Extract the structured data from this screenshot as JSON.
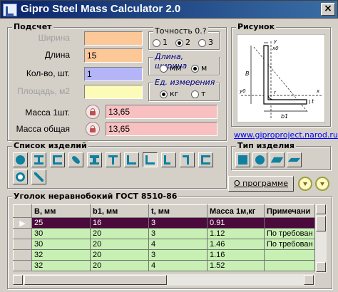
{
  "window": {
    "title": "Gipro Steel Mass Calculator 2.0",
    "close_glyph": "×"
  },
  "calc": {
    "legend": "Подсчет",
    "width_label": "Ширина",
    "length_label": "Длина",
    "length_value": "15",
    "count_label": "Кол-во, шт.",
    "count_value": "1",
    "area_label": "Площадь, м2",
    "mass_one_label": "Масса 1шт.",
    "mass_one_value": "13,65",
    "mass_total_label": "Масса общая",
    "mass_total_value": "13,65",
    "precision": {
      "legend": "Точность 0.?",
      "options": [
        "1",
        "2",
        "3"
      ],
      "selected": "2"
    },
    "length_units": {
      "legend": "Длина, ширина",
      "options": [
        "мм",
        "м"
      ],
      "selected": "м"
    },
    "mass_units": {
      "legend": "Ед. измерения",
      "options": [
        "кг",
        "т"
      ],
      "selected": "кг"
    }
  },
  "figure": {
    "legend": "Рисунок",
    "labels": {
      "width": "b1",
      "height": "B",
      "thickness": "t",
      "r": "r",
      "x0": "x0",
      "y0": "y0",
      "x": "x",
      "y": "y"
    }
  },
  "website_link": "www.giproproject.narod.ru",
  "products": {
    "legend": "Список изделий",
    "icons": [
      "circle-bar-icon",
      "i-beam-icon",
      "channel-icon",
      "rod-icon",
      "rail-icon",
      "t-beam-icon",
      "square-bar-icon",
      "equal-angle-icon",
      "unequal-angle-icon",
      "zee-icon",
      "hex-bar-icon",
      "pipe-icon",
      "diagonal-rod-icon"
    ]
  },
  "product_type": {
    "legend": "Тип изделия",
    "icons": [
      "square-type-icon",
      "round-type-icon",
      "flat-type-icon",
      "plate-type-icon"
    ]
  },
  "about_button": "О программе",
  "table": {
    "title": "Уголок неравнобокий ГОСТ 8510-86",
    "columns": [
      "B, мм",
      "b1, мм",
      "t, мм",
      "Масса 1м,кг",
      "Примечани"
    ],
    "rows": [
      [
        "25",
        "16",
        "3",
        "0.91",
        ""
      ],
      [
        "30",
        "20",
        "3",
        "1.12",
        "По требован"
      ],
      [
        "30",
        "20",
        "4",
        "1.46",
        "По требован"
      ],
      [
        "32",
        "20",
        "3",
        "1.16",
        ""
      ],
      [
        "32",
        "20",
        "4",
        "1.52",
        ""
      ]
    ],
    "selected_row": 0,
    "row_indicator": "▶"
  },
  "colors": {
    "title_gradient_start": "#0a246a",
    "input_orange": "#fcc898",
    "input_blue": "#b4b4f8",
    "input_yellow": "#fcfcb8",
    "result_pink": "#f8c0c0",
    "row_green": "#c8f0b4",
    "row_selected": "#4b0a3c"
  }
}
